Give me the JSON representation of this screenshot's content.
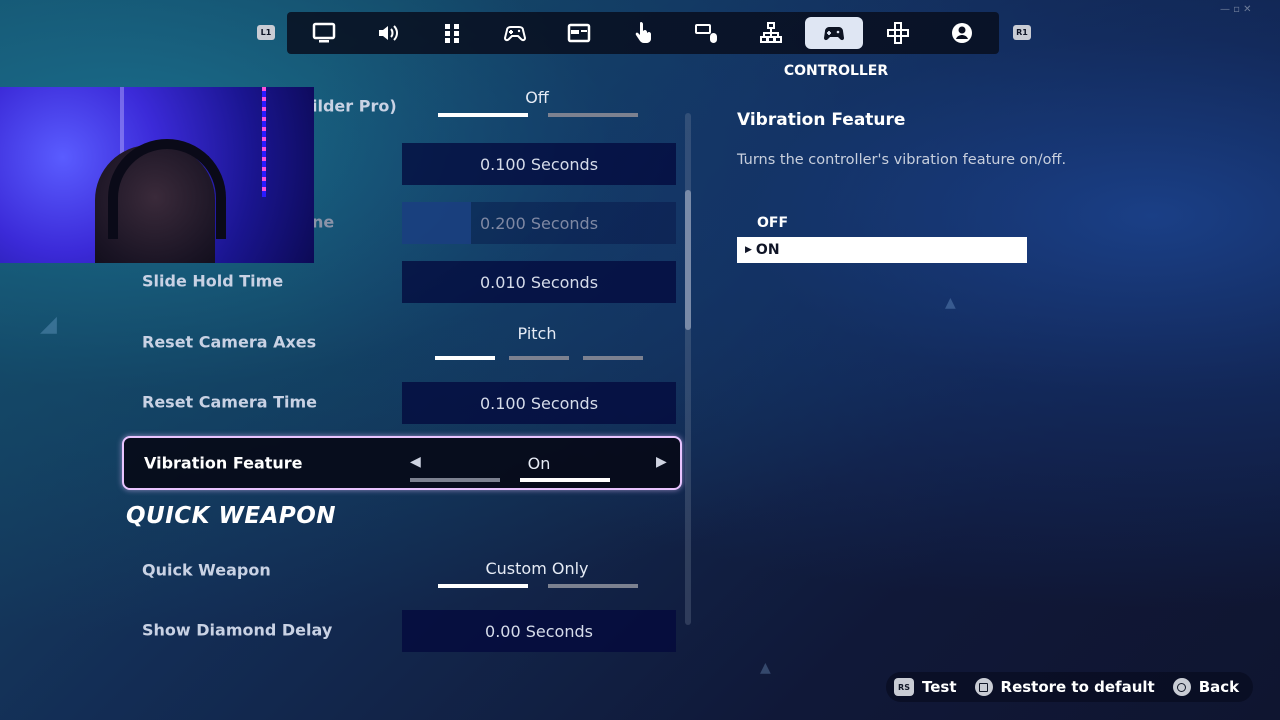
{
  "nav": {
    "left_bumper": "L1",
    "right_bumper": "R1",
    "tabs": [
      {
        "id": "display",
        "icon": "monitor-icon"
      },
      {
        "id": "audio",
        "icon": "speaker-icon"
      },
      {
        "id": "accessibility",
        "icon": "grid-icon"
      },
      {
        "id": "game",
        "icon": "gamepad-icon"
      },
      {
        "id": "game-ui",
        "icon": "window-icon"
      },
      {
        "id": "touch",
        "icon": "touch-icon"
      },
      {
        "id": "keyboard-mouse",
        "icon": "keyboard-mouse-icon"
      },
      {
        "id": "layout",
        "icon": "hierarchy-icon"
      },
      {
        "id": "controller",
        "icon": "controller-icon",
        "active": true
      },
      {
        "id": "controller-alt",
        "icon": "dpad-icon"
      },
      {
        "id": "account",
        "icon": "account-icon"
      }
    ],
    "active_title": "CONTROLLER"
  },
  "settings": {
    "row1": {
      "label": "ilder Pro)",
      "value": "Off"
    },
    "row2": {
      "value": "0.100 Seconds"
    },
    "row3": {
      "label": "ne",
      "value": "0.200 Seconds",
      "fill_fraction": 0.25
    },
    "slide_hold": {
      "label": "Slide Hold Time",
      "value": "0.010 Seconds"
    },
    "reset_axes": {
      "label": "Reset Camera Axes",
      "value": "Pitch",
      "selected_index": 0,
      "option_count": 3
    },
    "reset_time": {
      "label": "Reset Camera Time",
      "value": "0.100 Seconds"
    },
    "vibration": {
      "label": "Vibration Feature",
      "value": "On",
      "selected_index": 1,
      "option_count": 2
    },
    "group_heading": "QUICK WEAPON",
    "quick_weapon": {
      "label": "Quick Weapon",
      "value": "Custom Only",
      "selected_index": 0,
      "option_count": 2
    },
    "diamond_delay": {
      "label": "Show Diamond Delay",
      "value": "0.00 Seconds"
    }
  },
  "detail": {
    "title": "Vibration Feature",
    "description": "Turns the controller's vibration feature on/off.",
    "options": [
      "OFF",
      "ON"
    ],
    "selected": "ON"
  },
  "footer": {
    "test": "Test",
    "restore": "Restore to default",
    "back": "Back",
    "test_icon_label": "RS"
  }
}
